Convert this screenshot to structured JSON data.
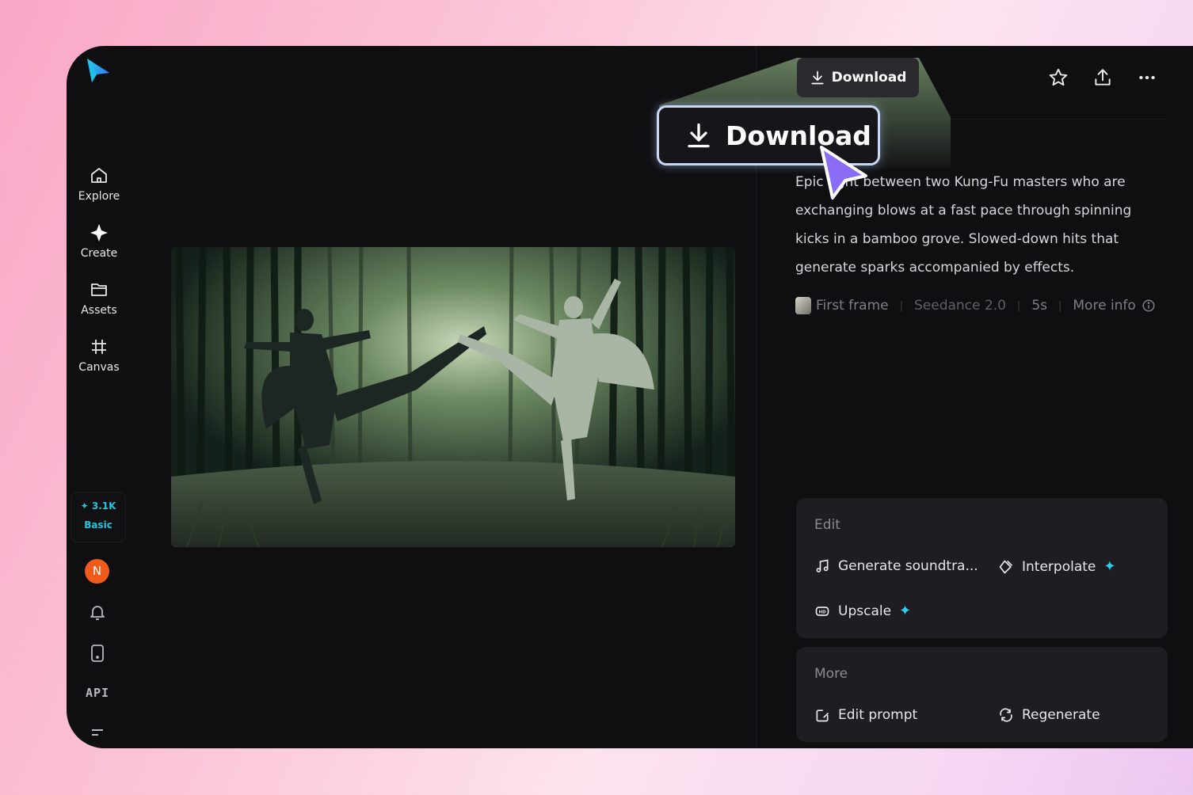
{
  "nav": {
    "items": [
      {
        "label": "Explore",
        "icon": "home-icon"
      },
      {
        "label": "Create",
        "icon": "sparkle-icon"
      },
      {
        "label": "Assets",
        "icon": "folder-icon"
      },
      {
        "label": "Canvas",
        "icon": "canvas-icon"
      }
    ],
    "credits": {
      "amount": "3.1K",
      "plan": "Basic"
    },
    "avatar_initial": "N",
    "api_label": "API"
  },
  "toolbar": {
    "download_label": "Download",
    "download_callout_label": "Download"
  },
  "details": {
    "description": "Epic fight between two Kung-Fu masters who are exchanging blows at a fast pace through spinning kicks in a bamboo grove. Slowed-down hits that generate sparks accompanied by effects.",
    "meta": {
      "first_frame": "First frame",
      "model": "Seedance 2.0",
      "duration": "5s",
      "more_info": "More info"
    }
  },
  "edit_card": {
    "title": "Edit",
    "actions": [
      {
        "label": "Generate soundtra...",
        "icon": "music-note-icon",
        "premium": false
      },
      {
        "label": "Interpolate",
        "icon": "interpolate-icon",
        "premium": true
      },
      {
        "label": "Upscale",
        "icon": "hd-icon",
        "premium": true
      }
    ]
  },
  "more_card": {
    "title": "More",
    "actions": [
      {
        "label": "Edit prompt",
        "icon": "edit-prompt-icon"
      },
      {
        "label": "Regenerate",
        "icon": "regenerate-icon"
      }
    ]
  },
  "colors": {
    "accent": "#23c4de",
    "avatar": "#f05a1a",
    "cursor": "#8b6cf5"
  }
}
